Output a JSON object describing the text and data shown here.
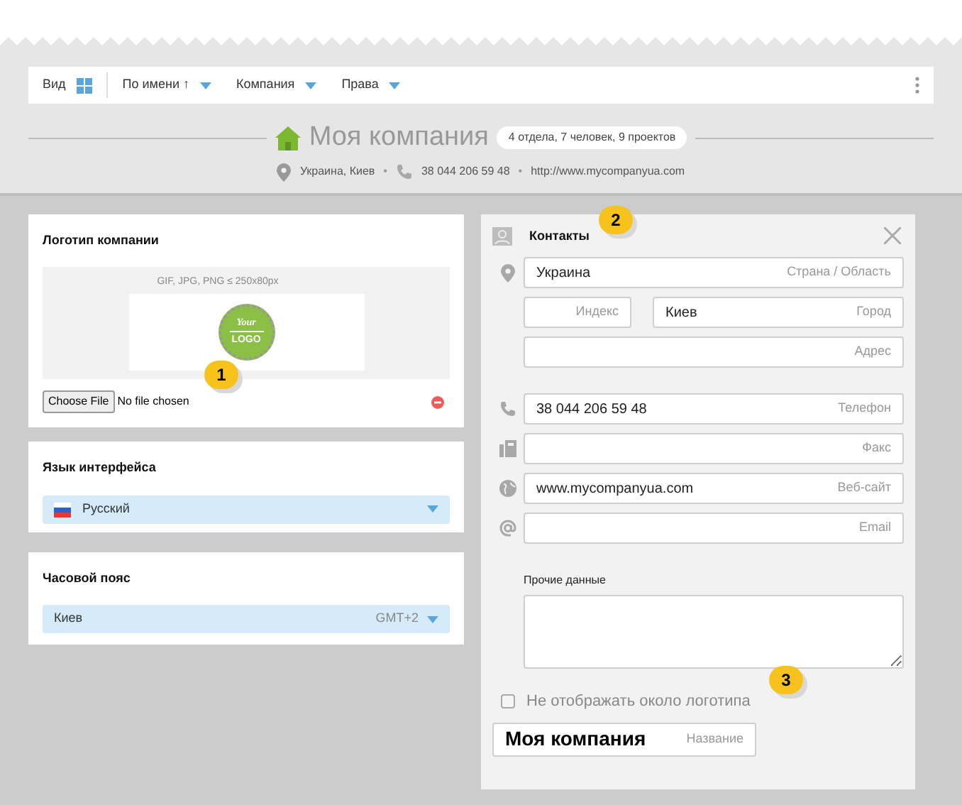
{
  "toolbar": {
    "view_label": "Вид",
    "menus": [
      {
        "label": "По имени ↑"
      },
      {
        "label": "Компания"
      },
      {
        "label": "Права"
      }
    ]
  },
  "header": {
    "title": "Моя компания",
    "badge": "4 отдела, 7 человек, 9 проектов",
    "location": "Украина, Киев",
    "phone": "38 044 206 59 48",
    "website": "http://www.mycompanyua.com",
    "separators": [
      "•",
      "•"
    ]
  },
  "logo_card": {
    "title": "Логотип компании",
    "hint": "GIF, JPG, PNG ≤ 250x80px",
    "logo_text": [
      "Your",
      "LOGO"
    ],
    "file_button": "Choose File",
    "file_status": "No file chosen",
    "callout": "1"
  },
  "language_card": {
    "title": "Язык интерфейса",
    "value": "Русский"
  },
  "timezone_card": {
    "title": "Часовой пояс",
    "value": "Киев",
    "offset": "GMT+2"
  },
  "contacts": {
    "title": "Контакты",
    "callout": "2",
    "address_rows": [
      [
        {
          "value": "Украина",
          "placeholder": "Страна / Область"
        }
      ],
      [
        {
          "placeholder": "Индекс"
        },
        {
          "value": "Киев",
          "placeholder": "Город"
        }
      ],
      [
        {
          "placeholder": "Адрес"
        }
      ]
    ],
    "channels": [
      {
        "kind": "phone",
        "value": "38 044 206 59 48",
        "placeholder": "Телефон"
      },
      {
        "kind": "fax",
        "placeholder": "Факс"
      },
      {
        "kind": "web",
        "value": "www.mycompanyua.com",
        "placeholder": "Веб-сайт"
      },
      {
        "kind": "email",
        "placeholder": "Email"
      }
    ],
    "other_label": "Прочие данные",
    "hide_option": {
      "label": "Не отображать около логотипа",
      "checked": false,
      "callout": "3"
    },
    "name_field": {
      "value": "Моя компания",
      "placeholder": "Название"
    }
  }
}
